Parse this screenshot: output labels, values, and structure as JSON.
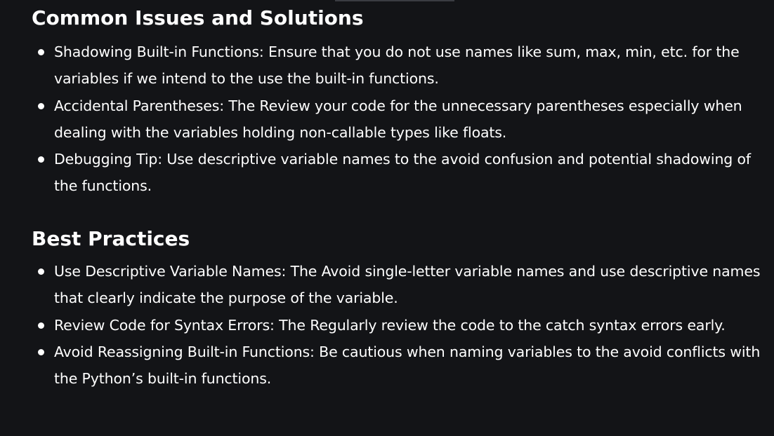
{
  "sections": [
    {
      "heading": "Common Issues and Solutions",
      "items": [
        {
          "text": "Shadowing Built-in Functions: Ensure that you do not use names like sum, max, min, etc. for the variables if we intend to the use the built-in functions."
        },
        {
          "text": "Accidental Parentheses: The Review your code for the unnecessary parentheses especially when dealing with the variables holding non-callable types like floats."
        },
        {
          "text": "Debugging Tip: Use descriptive variable names to the avoid confusion and potential shadowing of the functions."
        }
      ]
    },
    {
      "heading": "Best Practices",
      "items": [
        {
          "text": "Use Descriptive Variable Names: The Avoid single-letter variable names and use descriptive names that clearly indicate the purpose of the variable."
        },
        {
          "text": "Review Code for Syntax Errors: The Regularly review the code to the catch syntax errors early."
        },
        {
          "text": "Avoid Reassigning Built-in Functions: Be cautious when naming variables to the avoid conflicts with the Python’s built-in functions."
        }
      ]
    }
  ],
  "colors": {
    "background": "#131417",
    "text": "#ffffff"
  }
}
